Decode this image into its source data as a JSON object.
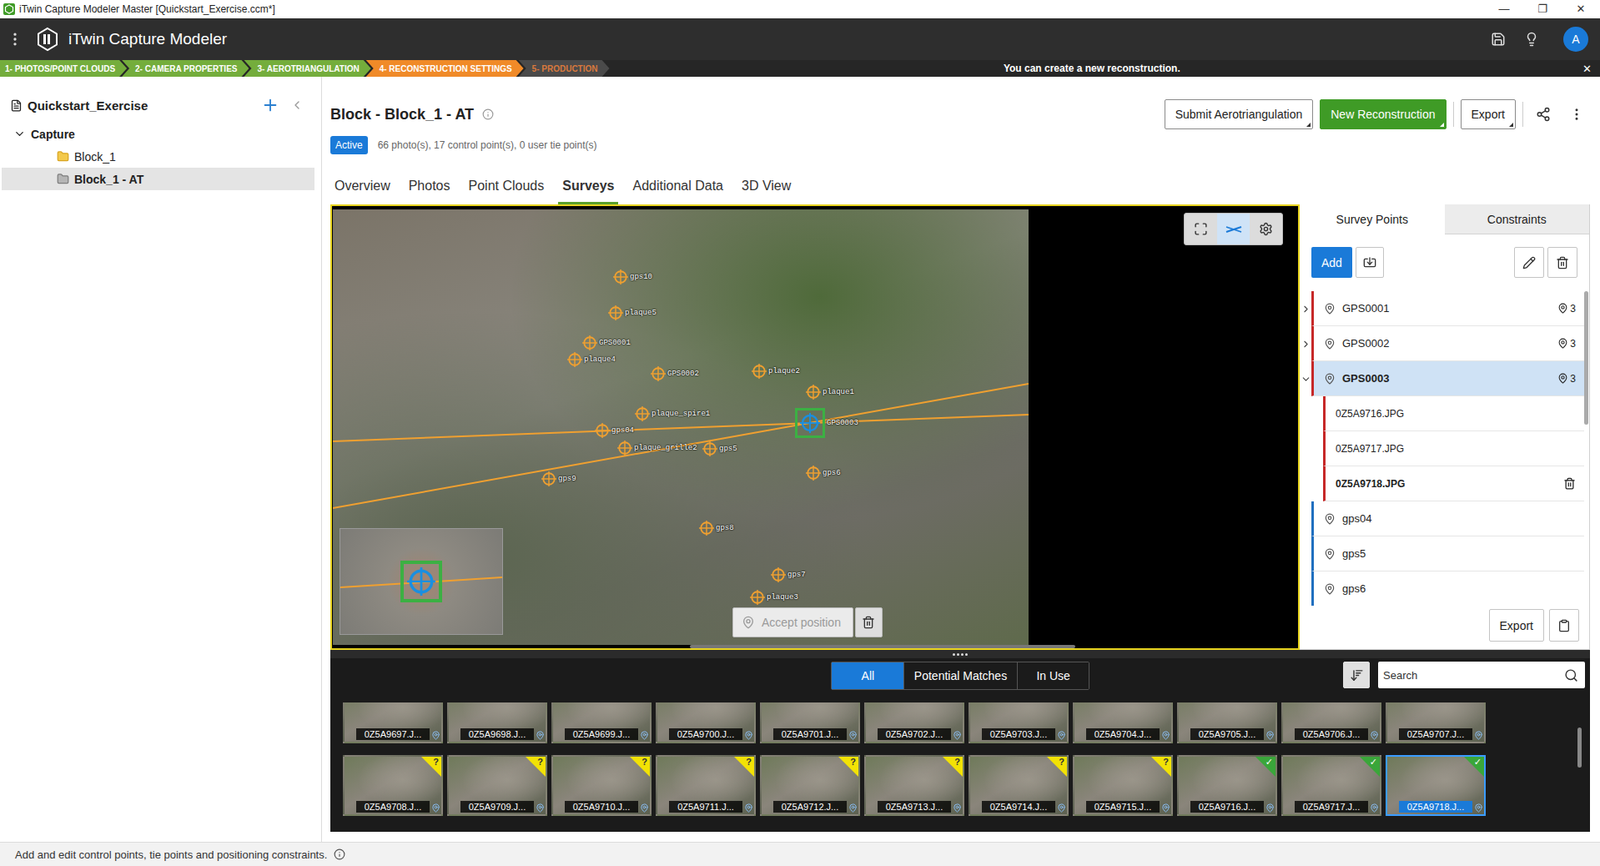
{
  "window": {
    "title": "iTwin Capture Modeler Master [Quickstart_Exercise.ccm*]",
    "controls": [
      "—",
      "❐",
      "✕"
    ]
  },
  "app_header": {
    "title": "iTwin Capture Modeler",
    "avatar": "A"
  },
  "workflow": {
    "steps": [
      {
        "label": "1- PHOTOS/POINT CLOUDS",
        "state": "done"
      },
      {
        "label": "2- CAMERA PROPERTIES",
        "state": "done"
      },
      {
        "label": "3- AEROTRIANGULATION",
        "state": "done"
      },
      {
        "label": "4- RECONSTRUCTION SETTINGS",
        "state": "current"
      },
      {
        "label": "5- PRODUCTION",
        "state": "pending"
      }
    ],
    "message": "You can create a new reconstruction.",
    "close": "✕"
  },
  "sidebar": {
    "project": "Quickstart_Exercise",
    "items": [
      {
        "label": "Capture",
        "kind": "group",
        "expanded": true,
        "selected": false
      },
      {
        "label": "Block_1",
        "kind": "block",
        "selected": false
      },
      {
        "label": "Block_1 - AT",
        "kind": "at-block",
        "selected": true
      }
    ]
  },
  "block": {
    "title": "Block - Block_1 - AT",
    "badge": "Active",
    "summary": "66 photo(s), 17 control point(s), 0 user tie point(s)",
    "actions": [
      {
        "label": "Submit Aerotriangulation",
        "kind": "secondary",
        "menu": true
      },
      {
        "label": "New Reconstruction",
        "kind": "primary",
        "menu": true
      },
      {
        "label": "Export",
        "kind": "secondary",
        "menu": true
      }
    ]
  },
  "tabs": [
    {
      "label": "Overview",
      "selected": false
    },
    {
      "label": "Photos",
      "selected": false
    },
    {
      "label": "Point Clouds",
      "selected": false
    },
    {
      "label": "Surveys",
      "selected": true
    },
    {
      "label": "Additional Data",
      "selected": false
    },
    {
      "label": "3D View",
      "selected": false
    }
  ],
  "viewer": {
    "tools": [
      {
        "kind": "fit",
        "selected": false
      },
      {
        "kind": "tie-lines",
        "selected": true
      },
      {
        "kind": "settings",
        "selected": false
      }
    ],
    "markers": [
      {
        "label": "gps10",
        "selected": false
      },
      {
        "label": "plaque5",
        "selected": false
      },
      {
        "label": "GPS0001",
        "selected": false
      },
      {
        "label": "plaque4",
        "selected": false
      },
      {
        "label": "GPS0002",
        "selected": false
      },
      {
        "label": "plaque2",
        "selected": false
      },
      {
        "label": "plaque1",
        "selected": false
      },
      {
        "label": "plaque_spire1",
        "selected": false
      },
      {
        "label": "gps04",
        "selected": false
      },
      {
        "label": "plaque_grille2",
        "selected": false
      },
      {
        "label": "gps5",
        "selected": false
      },
      {
        "label": "GPS0003",
        "selected": true
      },
      {
        "label": "gps6",
        "selected": false
      },
      {
        "label": "gps9",
        "selected": false
      },
      {
        "label": "gps8",
        "selected": false
      },
      {
        "label": "gps7",
        "selected": false
      },
      {
        "label": "plaque3",
        "selected": false
      }
    ],
    "accept_button": {
      "label": "Accept position",
      "disabled": true
    }
  },
  "panel": {
    "tabs": [
      {
        "label": "Survey Points",
        "selected": true
      },
      {
        "label": "Constraints",
        "selected": false
      }
    ],
    "add_button": "Add",
    "points": [
      {
        "label": "GPS0001",
        "kind": "measured",
        "count": "3",
        "expanded": false,
        "selected": false,
        "color": "#c62828",
        "photos": []
      },
      {
        "label": "GPS0002",
        "kind": "measured",
        "count": "3",
        "expanded": false,
        "selected": false,
        "color": "#c62828",
        "photos": []
      },
      {
        "label": "GPS0003",
        "kind": "measured",
        "count": "3",
        "expanded": true,
        "selected": true,
        "color": "#c62828",
        "photos": [
          {
            "label": "0Z5A9716.JPG",
            "selected": false
          },
          {
            "label": "0Z5A9717.JPG",
            "selected": false
          },
          {
            "label": "0Z5A9718.JPG",
            "selected": true
          }
        ]
      },
      {
        "label": "gps04",
        "kind": "unmeasured",
        "expanded": false,
        "selected": false,
        "color": "#1f6fbf",
        "photos": []
      },
      {
        "label": "gps5",
        "kind": "unmeasured",
        "expanded": false,
        "selected": false,
        "color": "#1f6fbf",
        "photos": []
      },
      {
        "label": "gps6",
        "kind": "unmeasured",
        "expanded": false,
        "selected": false,
        "color": "#1f6fbf",
        "photos": []
      }
    ],
    "export_button": "Export"
  },
  "filmstrip": {
    "filters": [
      {
        "label": "All",
        "selected": true
      },
      {
        "label": "Potential Matches",
        "selected": false
      },
      {
        "label": "In Use",
        "selected": false
      }
    ],
    "search": {
      "placeholder": "Search"
    },
    "photos": [
      {
        "label": "0Z5A9697.J...",
        "status": "low",
        "badge": "",
        "selected": false
      },
      {
        "label": "0Z5A9698.J...",
        "status": "low",
        "badge": "",
        "selected": false
      },
      {
        "label": "0Z5A9699.J...",
        "status": "low",
        "badge": "",
        "selected": false
      },
      {
        "label": "0Z5A9700.J...",
        "status": "low",
        "badge": "",
        "selected": false
      },
      {
        "label": "0Z5A9701.J...",
        "status": "low",
        "badge": "",
        "selected": false
      },
      {
        "label": "0Z5A9702.J...",
        "status": "low",
        "badge": "",
        "selected": false
      },
      {
        "label": "0Z5A9703.J...",
        "status": "low",
        "badge": "",
        "selected": false
      },
      {
        "label": "0Z5A9704.J...",
        "status": "low",
        "badge": "",
        "selected": false
      },
      {
        "label": "0Z5A9705.J...",
        "status": "low",
        "badge": "",
        "selected": false
      },
      {
        "label": "0Z5A9706.J...",
        "status": "low",
        "badge": "",
        "selected": false
      },
      {
        "label": "0Z5A9707.J...",
        "status": "low",
        "badge": "",
        "selected": false
      },
      {
        "label": "0Z5A9708.J...",
        "status": "potential",
        "badge": "?",
        "selected": false
      },
      {
        "label": "0Z5A9709.J...",
        "status": "potential",
        "badge": "?",
        "selected": false
      },
      {
        "label": "0Z5A9710.J...",
        "status": "potential",
        "badge": "?",
        "selected": false
      },
      {
        "label": "0Z5A9711.J...",
        "status": "potential",
        "badge": "?",
        "selected": false
      },
      {
        "label": "0Z5A9712.J...",
        "status": "potential",
        "badge": "?",
        "selected": false
      },
      {
        "label": "0Z5A9713.J...",
        "status": "potential",
        "badge": "?",
        "selected": false
      },
      {
        "label": "0Z5A9714.J...",
        "status": "potential",
        "badge": "?",
        "selected": false
      },
      {
        "label": "0Z5A9715.J...",
        "status": "potential",
        "badge": "?",
        "selected": false
      },
      {
        "label": "0Z5A9716.J...",
        "status": "used",
        "badge": "✓",
        "selected": false
      },
      {
        "label": "0Z5A9717.J...",
        "status": "used",
        "badge": "✓",
        "selected": false
      },
      {
        "label": "0Z5A9718.J...",
        "status": "used",
        "badge": "✓",
        "selected": true
      }
    ]
  },
  "status_bar": {
    "text": "Add and edit control points, tie points and positioning constraints."
  }
}
